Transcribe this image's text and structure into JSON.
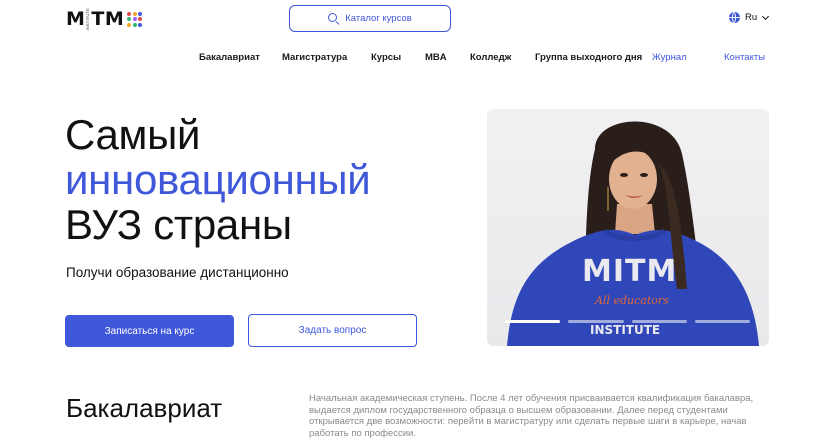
{
  "header": {
    "logo": {
      "text": "MITM",
      "subtext": "INSTITUTE",
      "dot_colors": [
        "#e5484d",
        "#f5a623",
        "#3f57d9",
        "#2eb872",
        "#a259ff",
        "#e5484d",
        "#f5a623",
        "#2eb872",
        "#3f57d9"
      ]
    },
    "search": {
      "label": "Каталог курсов",
      "icon": "search-icon"
    },
    "language": {
      "value": "Ru",
      "icon": "globe-icon"
    }
  },
  "nav": {
    "items": [
      {
        "label": "Бакалавриат"
      },
      {
        "label": "Магистратура"
      },
      {
        "label": "Курсы"
      },
      {
        "label": "MBA"
      },
      {
        "label": "Колледж"
      },
      {
        "label": "Группа выходного дня"
      },
      {
        "label": "Журнал"
      },
      {
        "label": "Контакты"
      }
    ]
  },
  "hero": {
    "title_line1": "Самый",
    "title_line2": "инновационный",
    "title_line3": "ВУЗ страны",
    "subtitle": "Получи образование дистанционно",
    "primary_button": "Записаться на курс",
    "secondary_button": "Задать вопрос",
    "carousel": {
      "slides": 4,
      "active": 1
    }
  },
  "section": {
    "title": "Бакалавриат",
    "description": "Начальная академическая ступень. После 4 лет обучения присваивается квалификация бакалавра, выдается диплом государственного образца о высшем образовании. Далее перед студентами открывается две возможности: перейти в магистратуру или сделать первые шаги в карьере, начав работать по профессии."
  },
  "colors": {
    "accent": "#3f57d9",
    "text": "#111111",
    "muted": "#8a8a8a"
  }
}
